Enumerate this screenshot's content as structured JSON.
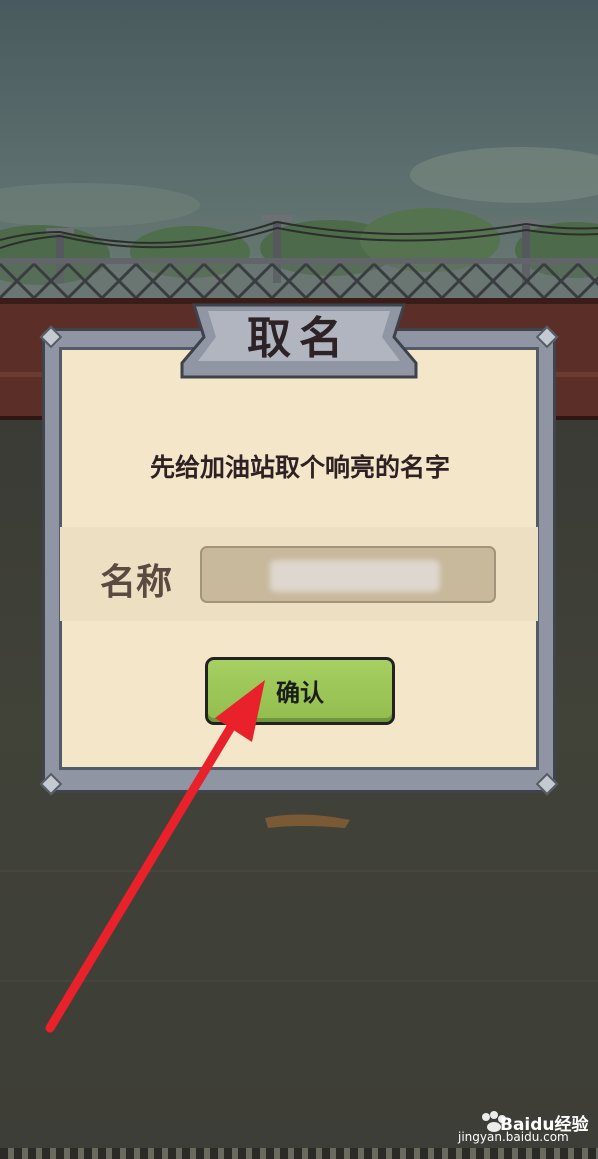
{
  "dialog": {
    "title": "取名",
    "prompt": "先给加油站取个响亮的名字",
    "name_label": "名称",
    "name_value": "",
    "confirm_label": "确认"
  },
  "watermark": {
    "brand": "Baidu经验",
    "url": "jingyan.baidu.com"
  },
  "colors": {
    "panel_frame": "#8f95a3",
    "panel_paper": "#f4e6c8",
    "confirm_button": "#9fc85b",
    "annotation_arrow": "#e8212b"
  }
}
